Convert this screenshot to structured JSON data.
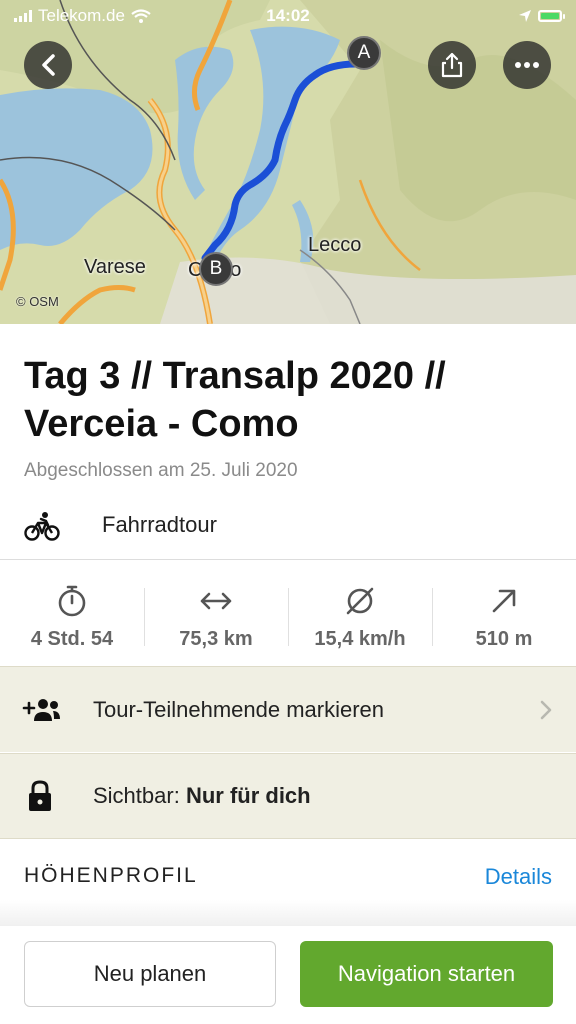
{
  "status_bar": {
    "carrier": "Telekom.de",
    "time": "14:02"
  },
  "map": {
    "cities": {
      "varese": "Varese",
      "lecco": "Lecco",
      "como": "Como"
    },
    "markers": {
      "start": "A",
      "end": "B"
    },
    "attribution": "© OSM",
    "route_color": "#1b4fd6"
  },
  "tour": {
    "title": "Tag 3 // Transalp 2020 // Verceia - Como",
    "completed": "Abgeschlossen am 25. Juli 2020",
    "activity_icon": "bicycle-icon",
    "activity": "Fahrradtour"
  },
  "stats": [
    {
      "icon": "stopwatch-icon",
      "value": "4 Std. 54"
    },
    {
      "icon": "arrows-horizontal-icon",
      "value": "75,3 km"
    },
    {
      "icon": "average-icon",
      "value": "15,4 km/h"
    },
    {
      "icon": "arrow-up-right-icon",
      "value": "510 m"
    }
  ],
  "participants": {
    "icon": "add-person-icon",
    "label": "Tour-Teilnehmende markieren"
  },
  "visibility": {
    "icon": "lock-icon",
    "label": "Sichtbar: ",
    "value": "Nur für dich"
  },
  "elevation": {
    "heading": "HÖHENPROFIL",
    "details": "Details"
  },
  "actions": {
    "plan": "Neu planen",
    "navigate": "Navigation starten"
  },
  "colors": {
    "accent_green": "#62a82e",
    "link_blue": "#1a87d9",
    "row_bg": "#f0efe3"
  }
}
